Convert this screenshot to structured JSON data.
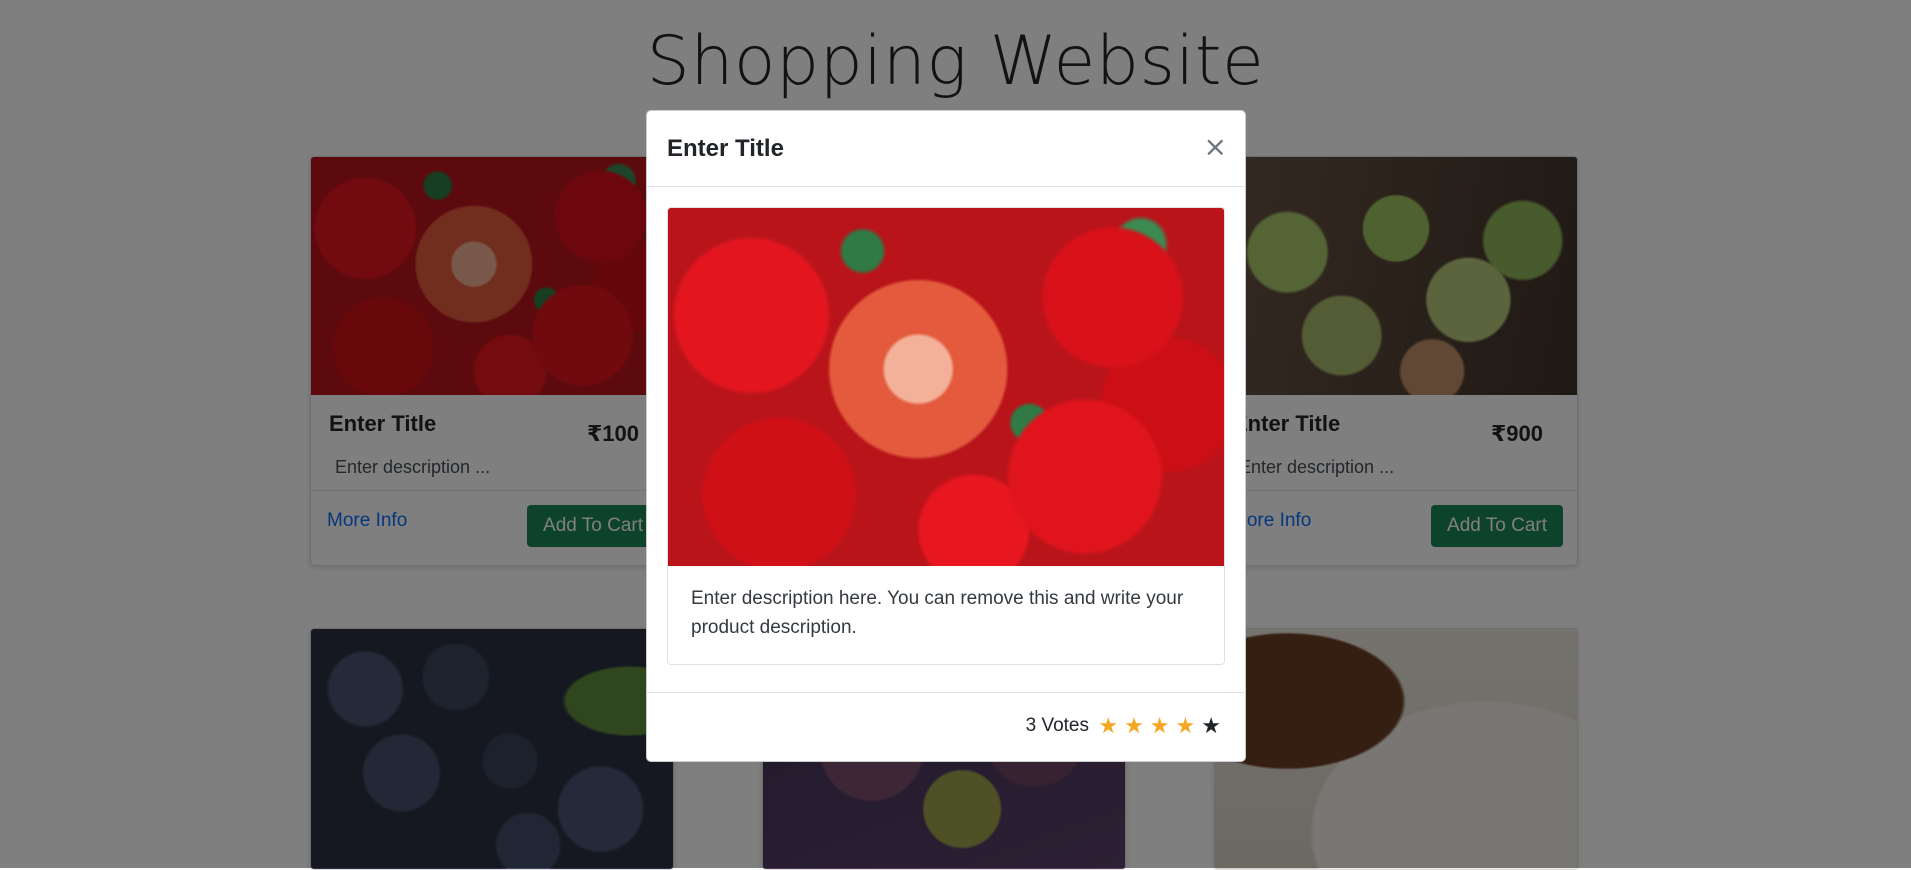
{
  "site": {
    "title": "Shopping Website"
  },
  "cards": [
    {
      "title": "Enter Title",
      "price": "₹100",
      "description": "Enter description ...",
      "more_info": "More Info",
      "add_to_cart": "Add To Cart"
    },
    {
      "title": "Enter Title",
      "price": "₹900",
      "description": "Enter description ...",
      "more_info": "More Info",
      "add_to_cart": "Add To Cart"
    }
  ],
  "modal": {
    "title": "Enter Title",
    "close_icon": "×",
    "description": "Enter description here. You can remove this and write your product description.",
    "votes": "3 Votes",
    "rating": {
      "filled": 4,
      "total": 5,
      "filled_color": "#f5a623",
      "empty_color": "#212529"
    }
  },
  "colors": {
    "primary_link": "#0d6efd",
    "cart_button": "#198754",
    "backdrop": "rgba(0,0,0,0.5)"
  }
}
